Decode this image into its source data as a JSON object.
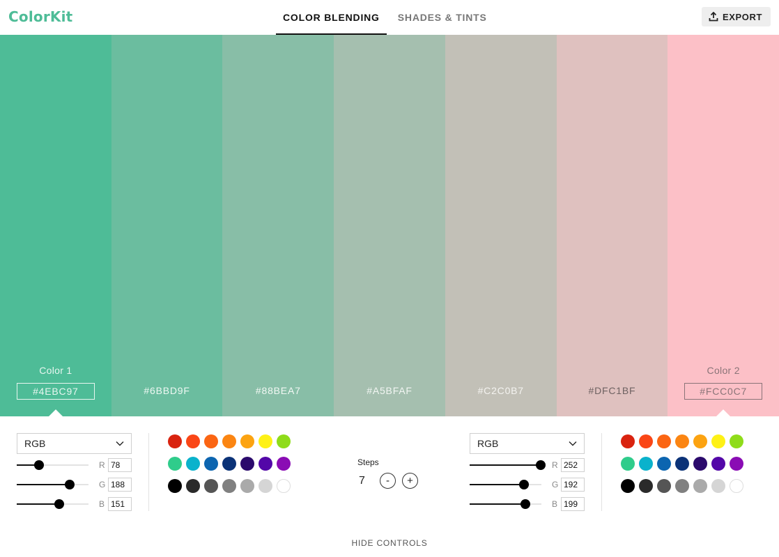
{
  "header": {
    "logo": "ColorKit",
    "tabs": [
      {
        "label": "COLOR BLENDING",
        "active": true
      },
      {
        "label": "SHADES & TINTS",
        "active": false
      }
    ],
    "export_label": "EXPORT",
    "export_icon": "upload-icon"
  },
  "swatches": [
    {
      "hex": "#4EBC97",
      "name": "Color 1",
      "text_color": "#e8f6f0",
      "endpoint": true
    },
    {
      "hex": "#6BBD9F",
      "name": "",
      "text_color": "#eef8f3",
      "endpoint": false
    },
    {
      "hex": "#88BEA7",
      "name": "",
      "text_color": "#f2f8f4",
      "endpoint": false
    },
    {
      "hex": "#A5BFAF",
      "name": "",
      "text_color": "#f2f6f3",
      "endpoint": false
    },
    {
      "hex": "#C2C0B7",
      "name": "",
      "text_color": "#f4f3f0",
      "endpoint": false
    },
    {
      "hex": "#DFC1BF",
      "name": "",
      "text_color": "#6e6262",
      "endpoint": false
    },
    {
      "hex": "#FCC0C7",
      "name": "Color 2",
      "text_color": "#8a7478",
      "endpoint": true
    }
  ],
  "color1": {
    "mode": "RGB",
    "channels": [
      {
        "label": "R",
        "value": "78"
      },
      {
        "label": "G",
        "value": "188"
      },
      {
        "label": "B",
        "value": "151"
      }
    ]
  },
  "color2": {
    "mode": "RGB",
    "channels": [
      {
        "label": "R",
        "value": "252"
      },
      {
        "label": "G",
        "value": "192"
      },
      {
        "label": "B",
        "value": "199"
      }
    ]
  },
  "palette": [
    [
      "#d9230f",
      "#fa4616",
      "#fb6513",
      "#fb8512",
      "#fca311",
      "#fef116",
      "#8fdc1a"
    ],
    [
      "#2fcc8b",
      "#0ab2cc",
      "#0c65b0",
      "#0b3277",
      "#2b0a6c",
      "#5307a8",
      "#8a0cb4"
    ],
    [
      "#000000",
      "#2a2a2a",
      "#555555",
      "#808080",
      "#aaaaaa",
      "#d5d5d5",
      "#ffffff"
    ]
  ],
  "steps": {
    "label": "Steps",
    "value": "7",
    "minus": "-",
    "plus": "+"
  },
  "footer": {
    "hide_controls": "HIDE CONTROLS"
  }
}
